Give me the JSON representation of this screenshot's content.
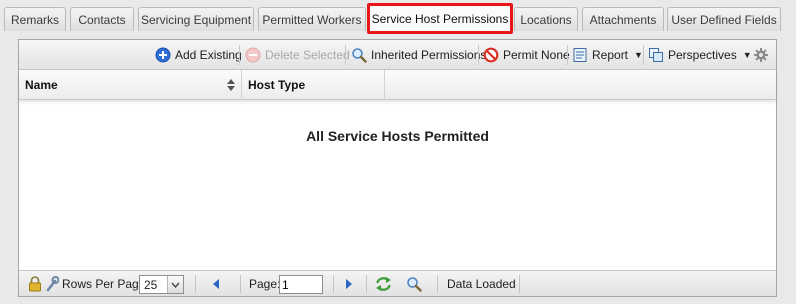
{
  "tabs": [
    {
      "label": "Remarks"
    },
    {
      "label": "Contacts"
    },
    {
      "label": "Servicing Equipment"
    },
    {
      "label": "Permitted Workers"
    },
    {
      "label": "Service Host Permissions",
      "active": true
    },
    {
      "label": "Locations"
    },
    {
      "label": "Attachments"
    },
    {
      "label": "User Defined Fields"
    }
  ],
  "toolbar": {
    "add_existing": "Add Existing",
    "delete_selected": "Delete Selected",
    "inherited_permissions": "Inherited Permissions",
    "permit_none": "Permit None",
    "report": "Report",
    "perspectives": "Perspectives"
  },
  "grid": {
    "columns": [
      {
        "label": "Name"
      },
      {
        "label": "Host Type"
      }
    ],
    "empty_message": "All Service Hosts Permitted"
  },
  "footer": {
    "rows_per_page_label": "Rows Per Page:",
    "rows_per_page_value": "25",
    "page_label": "Page:",
    "page_value": "1",
    "status": "Data Loaded"
  },
  "colors": {
    "active_tab_border": "#e8161b",
    "add_icon": "#2d6fd6",
    "permit_none_icon": "#d9332b",
    "refresh_icon": "#3d9b3a",
    "nav_arrow": "#2a64c4"
  }
}
